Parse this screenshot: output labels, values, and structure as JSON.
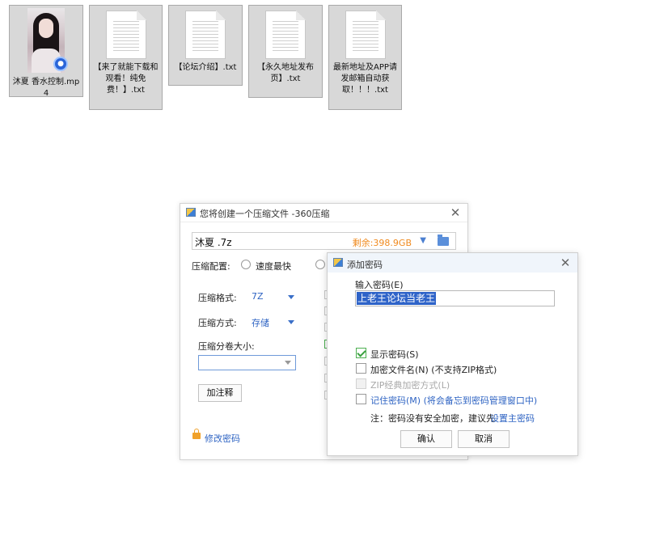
{
  "desktop": {
    "files": [
      {
        "label": "沐夏 香水控制.mp4",
        "kind": "video"
      },
      {
        "label": "【来了就能下载和观看！纯免费！】.txt",
        "kind": "text"
      },
      {
        "label": "【论坛介绍】.txt",
        "kind": "text"
      },
      {
        "label": "【永久地址发布页】.txt",
        "kind": "text"
      },
      {
        "label": "最新地址及APP请发邮箱自动获取！！！.txt",
        "kind": "text"
      }
    ]
  },
  "compress_window": {
    "title": "您将创建一个压缩文件 -360压缩",
    "archive_name": "沐夏 .7z",
    "free_space": "剩余:398.9GB",
    "config_label": "压缩配置:",
    "speed_option": "速度最快",
    "format_label": "压缩格式:",
    "format_value": "7Z",
    "method_label": "压缩方式:",
    "method_value": "存储",
    "split_label": "压缩分卷大小:",
    "split_value": "",
    "comment_button": "加注释",
    "change_password_link": "修改密码"
  },
  "password_dialog": {
    "title": "添加密码",
    "input_label": "输入密码(E)",
    "password_value": "上老王论坛当老王",
    "options": [
      {
        "label": "显示密码(S)",
        "checked": true,
        "disabled": false
      },
      {
        "label": "加密文件名(N) (不支持ZIP格式)",
        "checked": false,
        "disabled": false
      },
      {
        "label": "ZIP经典加密方式(L)",
        "checked": false,
        "disabled": true
      },
      {
        "label": "记住密码(M) (将会备忘到密码管理窗口中)",
        "checked": false,
        "disabled": false
      }
    ],
    "note_prefix": "注：密码没有安全加密，建议先",
    "note_link": "设置主密码",
    "ok_button": "确认",
    "cancel_button": "取消"
  },
  "colors": {
    "accent_blue": "#2f64c3",
    "free_space_orange": "#f08a1e",
    "selection_blue": "#2e63c8"
  }
}
